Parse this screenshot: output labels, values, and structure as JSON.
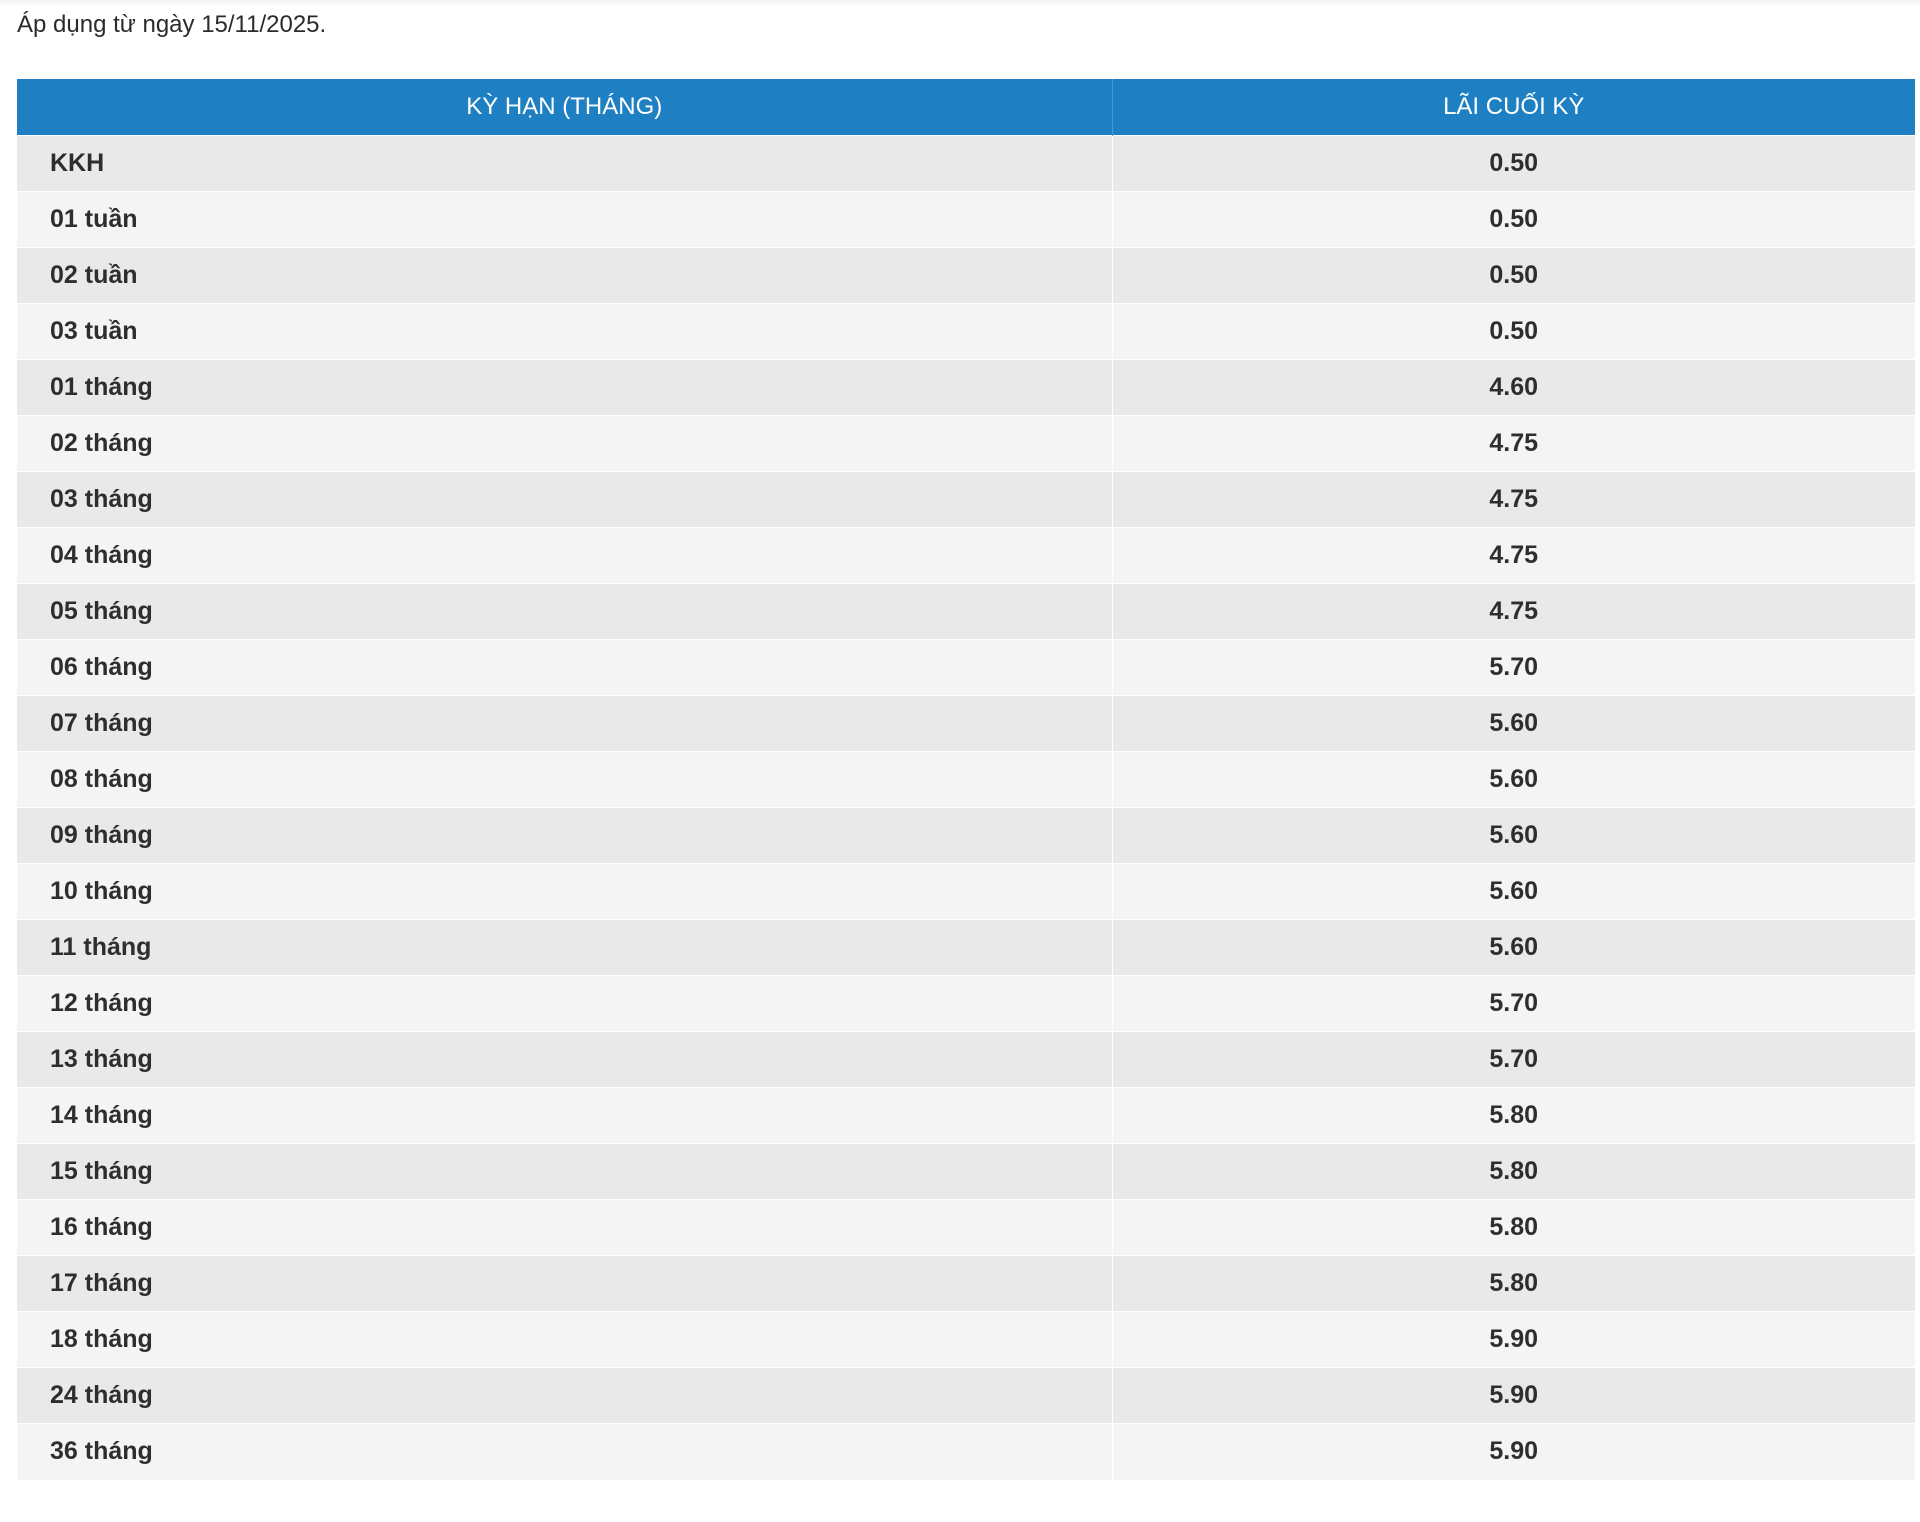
{
  "notice": "Áp dụng từ ngày 15/11/2025.",
  "table": {
    "headers": [
      "KỲ HẠN (THÁNG)",
      "LÃI CUỐI KỲ"
    ],
    "rows": [
      {
        "term": "KKH",
        "rate": "0.50"
      },
      {
        "term": "01 tuần",
        "rate": "0.50"
      },
      {
        "term": "02 tuần",
        "rate": "0.50"
      },
      {
        "term": "03 tuần",
        "rate": "0.50"
      },
      {
        "term": "01 tháng",
        "rate": "4.60"
      },
      {
        "term": "02 tháng",
        "rate": "4.75"
      },
      {
        "term": "03 tháng",
        "rate": "4.75"
      },
      {
        "term": "04 tháng",
        "rate": "4.75"
      },
      {
        "term": "05 tháng",
        "rate": "4.75"
      },
      {
        "term": "06 tháng",
        "rate": "5.70"
      },
      {
        "term": "07 tháng",
        "rate": "5.60"
      },
      {
        "term": "08 tháng",
        "rate": "5.60"
      },
      {
        "term": "09 tháng",
        "rate": "5.60"
      },
      {
        "term": "10 tháng",
        "rate": "5.60"
      },
      {
        "term": "11 tháng",
        "rate": "5.60"
      },
      {
        "term": "12 tháng",
        "rate": "5.70"
      },
      {
        "term": "13 tháng",
        "rate": "5.70"
      },
      {
        "term": "14 tháng",
        "rate": "5.80"
      },
      {
        "term": "15 tháng",
        "rate": "5.80"
      },
      {
        "term": "16 tháng",
        "rate": "5.80"
      },
      {
        "term": "17 tháng",
        "rate": "5.80"
      },
      {
        "term": "18 tháng",
        "rate": "5.90"
      },
      {
        "term": "24 tháng",
        "rate": "5.90"
      },
      {
        "term": "36 tháng",
        "rate": "5.90"
      }
    ]
  },
  "colors": {
    "header_bg": "#1e7fc2",
    "row_odd": "#e9e9e9",
    "row_even": "#f4f4f4"
  }
}
